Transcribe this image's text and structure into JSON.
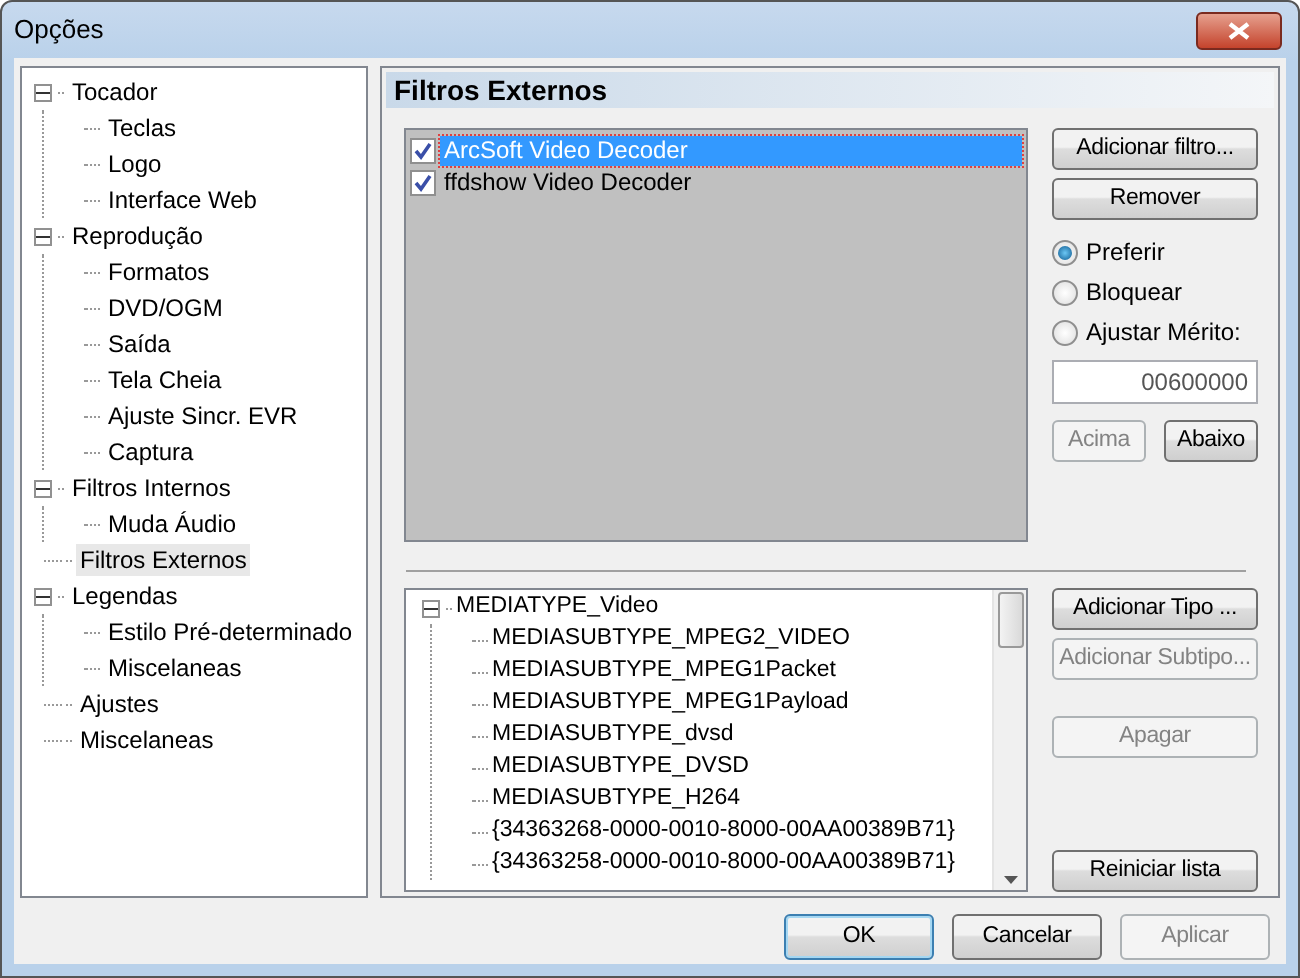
{
  "window": {
    "title": "Opções"
  },
  "sidebar": {
    "items": [
      {
        "label": "Tocador",
        "expanded": true,
        "selected": false,
        "children": [
          {
            "label": "Teclas",
            "selected": false
          },
          {
            "label": "Logo",
            "selected": false
          },
          {
            "label": "Interface Web",
            "selected": false
          }
        ]
      },
      {
        "label": "Reprodução",
        "expanded": true,
        "selected": false,
        "children": [
          {
            "label": "Formatos",
            "selected": false
          },
          {
            "label": "DVD/OGM",
            "selected": false
          },
          {
            "label": "Saída",
            "selected": false
          },
          {
            "label": "Tela Cheia",
            "selected": false
          },
          {
            "label": "Ajuste Sincr. EVR",
            "selected": false
          },
          {
            "label": "Captura",
            "selected": false
          }
        ]
      },
      {
        "label": "Filtros Internos",
        "expanded": true,
        "selected": false,
        "children": [
          {
            "label": "Muda Áudio",
            "selected": false
          }
        ]
      },
      {
        "label": "Filtros Externos",
        "selected": true
      },
      {
        "label": "Legendas",
        "expanded": true,
        "selected": false,
        "children": [
          {
            "label": "Estilo Pré-determinado",
            "selected": false
          },
          {
            "label": "Miscelaneas",
            "selected": false
          }
        ]
      },
      {
        "label": "Ajustes",
        "selected": false
      },
      {
        "label": "Miscelaneas",
        "selected": false
      }
    ]
  },
  "page_title": "Filtros Externos",
  "filters": [
    {
      "label": "ArcSoft Video Decoder",
      "checked": true,
      "selected": true
    },
    {
      "label": "ffdshow Video Decoder",
      "checked": true,
      "selected": false
    }
  ],
  "filter_buttons": [
    {
      "label": "Adicionar filtro...",
      "disabled": false
    },
    {
      "label": "Remover",
      "disabled": false
    }
  ],
  "filter_mode": [
    {
      "label": "Preferir",
      "selected": true
    },
    {
      "label": "Bloquear",
      "selected": false
    },
    {
      "label": "Ajustar Mérito:",
      "selected": false
    }
  ],
  "merit": {
    "value": "00600000"
  },
  "order_buttons": [
    {
      "label": "Acima",
      "disabled": true
    },
    {
      "label": "Abaixo",
      "disabled": false
    }
  ],
  "media_types": [
    {
      "label": "MEDIATYPE_Video",
      "expanded": true,
      "children": [
        {
          "label": "MEDIASUBTYPE_MPEG2_VIDEO"
        },
        {
          "label": "MEDIASUBTYPE_MPEG1Packet"
        },
        {
          "label": "MEDIASUBTYPE_MPEG1Payload"
        },
        {
          "label": "MEDIASUBTYPE_dvsd"
        },
        {
          "label": "MEDIASUBTYPE_DVSD"
        },
        {
          "label": "MEDIASUBTYPE_H264"
        },
        {
          "label": "{34363268-0000-0010-8000-00AA00389B71}"
        },
        {
          "label": "{34363258-0000-0010-8000-00AA00389B71}"
        }
      ]
    }
  ],
  "type_buttons": [
    {
      "label": "Adicionar Tipo ...",
      "disabled": false
    },
    {
      "label": "Adicionar Subtipo...",
      "disabled": true
    },
    {
      "label": "Apagar",
      "disabled": true
    }
  ],
  "reset_button": {
    "label": "Reiniciar lista",
    "disabled": false
  },
  "dialog_buttons": [
    {
      "label": "OK",
      "disabled": false,
      "default": true
    },
    {
      "label": "Cancelar",
      "disabled": false,
      "default": false
    },
    {
      "label": "Aplicar",
      "disabled": true,
      "default": false
    }
  ]
}
